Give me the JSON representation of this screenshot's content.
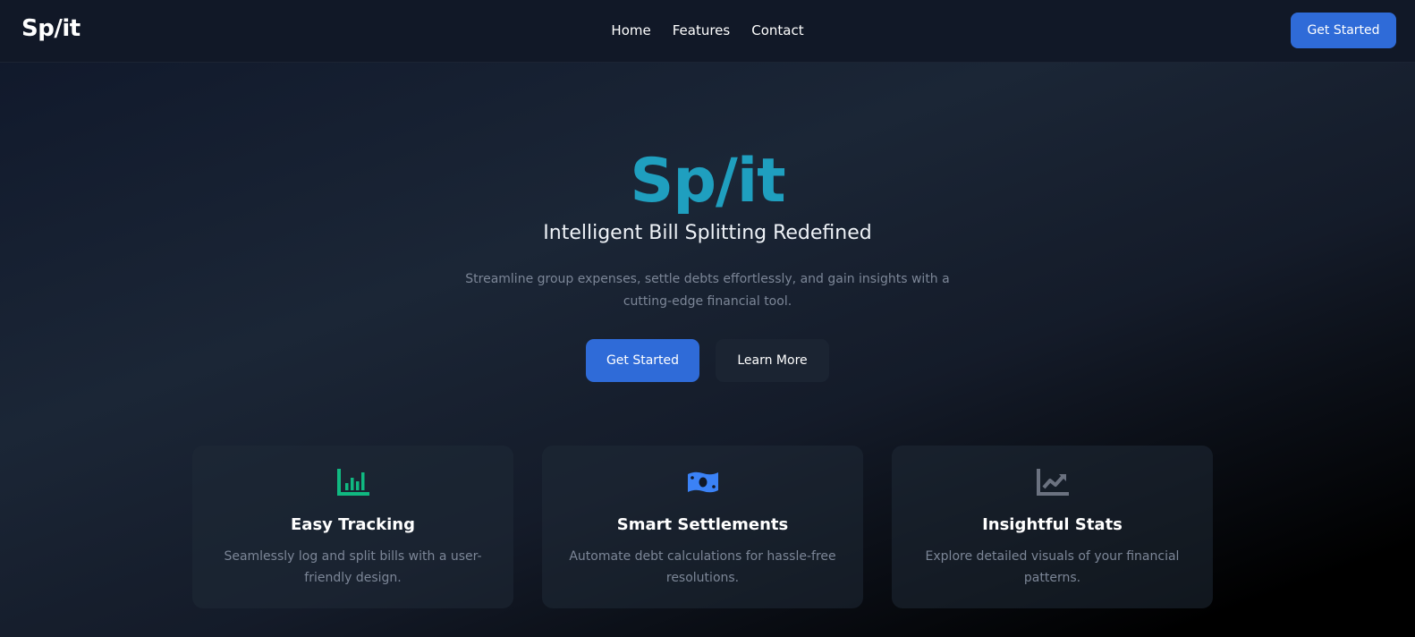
{
  "nav": {
    "brand": "Sp/it",
    "links": [
      "Home",
      "Features",
      "Contact"
    ],
    "cta": "Get Started"
  },
  "hero": {
    "title": "Sp/it",
    "subtitle": "Intelligent Bill Splitting Redefined",
    "description": "Streamline group expenses, settle debts effortlessly, and gain insights with a cutting-edge financial tool.",
    "primary_button": "Get Started",
    "secondary_button": "Learn More"
  },
  "features": [
    {
      "icon": "bar-chart-icon",
      "icon_color": "#10b981",
      "title": "Easy Tracking",
      "description": "Seamlessly log and split bills with a user-friendly design."
    },
    {
      "icon": "money-bill-icon",
      "icon_color": "#3b82f6",
      "title": "Smart Settlements",
      "description": "Automate debt calculations for hassle-free resolutions."
    },
    {
      "icon": "trend-chart-icon",
      "icon_color": "#6b7280",
      "title": "Insightful Stats",
      "description": "Explore detailed visuals of your financial patterns."
    }
  ],
  "colors": {
    "accent": "#2f6bd8",
    "brand_teal": "#1f9fbf"
  }
}
